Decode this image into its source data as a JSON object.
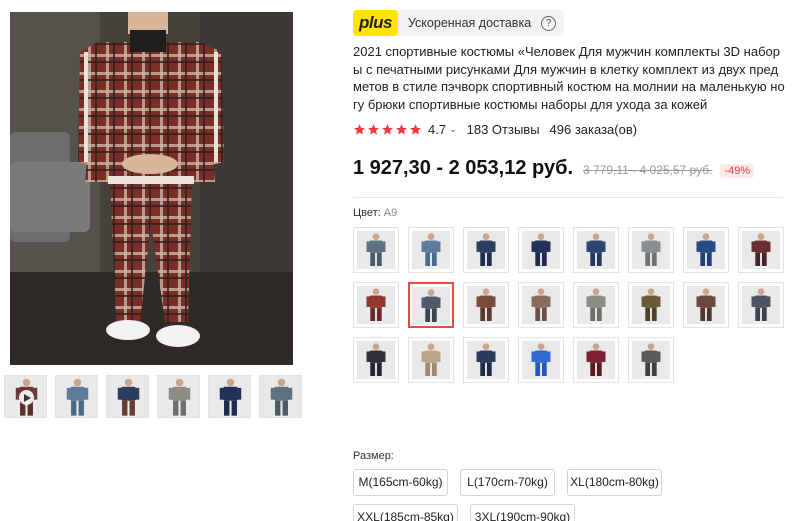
{
  "delivery": {
    "badge": "plus",
    "text": "Ускоренная доставка",
    "help": "?"
  },
  "product": {
    "title": "2021 спортивные костюмы «Человек Для мужчин комплекты 3D наборы с печатными рисунками Для мужчин в клетку комплект из двух предметов в стиле пэчворк спортивный костюм на молнии на маленькую ногу брюки спортивные костюмы наборы для ухода за кожей",
    "rating": "4.7",
    "reviews": "183 Отзывы",
    "orders": "496 заказа(ов)"
  },
  "price": {
    "current": "1 927,30 - 2 053,12 руб.",
    "old": "3 779,11 - 4 025,57 руб.",
    "discount": "-49%"
  },
  "color": {
    "label": "Цвет:",
    "value": "A9"
  },
  "size": {
    "label": "Размер:",
    "options": [
      "M(165cm-60kg)",
      "L(170cm-70kg)",
      "XL(180cm-80kg)",
      "XXL(185cm-85kg)",
      "3XL(190cm-90kg)"
    ]
  },
  "colors": {
    "star": "#f13b3b",
    "selected_border": "#e34b4b",
    "plus_yellow": "#ffe500"
  },
  "swatches": [
    {
      "top": "#5f7180",
      "pants": "#4b5a66"
    },
    {
      "top": "#5d7b9a",
      "pants": "#4a6a8a"
    },
    {
      "top": "#2b3e5e",
      "pants": "#1f2f4a"
    },
    {
      "top": "#23325a",
      "pants": "#1c2a4d"
    },
    {
      "top": "#2e4470",
      "pants": "#26385d"
    },
    {
      "top": "#8a8f93",
      "pants": "#6e7377"
    },
    {
      "top": "#2a4a86",
      "pants": "#22407a"
    },
    {
      "top": "#6b2e30",
      "pants": "#4a2528"
    },
    {
      "top": "#8d3a2f",
      "pants": "#6b2c25"
    },
    {
      "top": "#4f5b6a",
      "pants": "#3a4452"
    },
    {
      "top": "#7a4a3a",
      "pants": "#5a3a30"
    },
    {
      "top": "#8a6a5a",
      "pants": "#6a5046"
    },
    {
      "top": "#8d8d86",
      "pants": "#6f6f69"
    },
    {
      "top": "#6a5a3a",
      "pants": "#4d412c"
    },
    {
      "top": "#6a4a40",
      "pants": "#4f3a33"
    },
    {
      "top": "#4a5560",
      "pants": "#3a444e"
    },
    {
      "top": "#2f3238",
      "pants": "#24262b"
    },
    {
      "top": "#b9a58a",
      "pants": "#9c8a72"
    },
    {
      "top": "#2a3a5a",
      "pants": "#1e2b45"
    },
    {
      "top": "#2f6ad0",
      "pants": "#2558b8"
    },
    {
      "top": "#7a2030",
      "pants": "#5a1a26"
    },
    {
      "top": "#5a5a5a",
      "pants": "#3f3f3f"
    }
  ],
  "thumbs": [
    {
      "top": "#6b3a30",
      "pants": "#5a2f28",
      "video": true
    },
    {
      "top": "#5d7b9a",
      "pants": "#4a6a8a",
      "video": false
    },
    {
      "top": "#2b3e5e",
      "pants": "#6b3a30",
      "video": false
    },
    {
      "top": "#8d8d86",
      "pants": "#6f6f69",
      "video": false
    },
    {
      "top": "#23325a",
      "pants": "#1c2a4d",
      "video": false
    },
    {
      "top": "#5f7180",
      "pants": "#4b5a66",
      "video": false
    }
  ]
}
